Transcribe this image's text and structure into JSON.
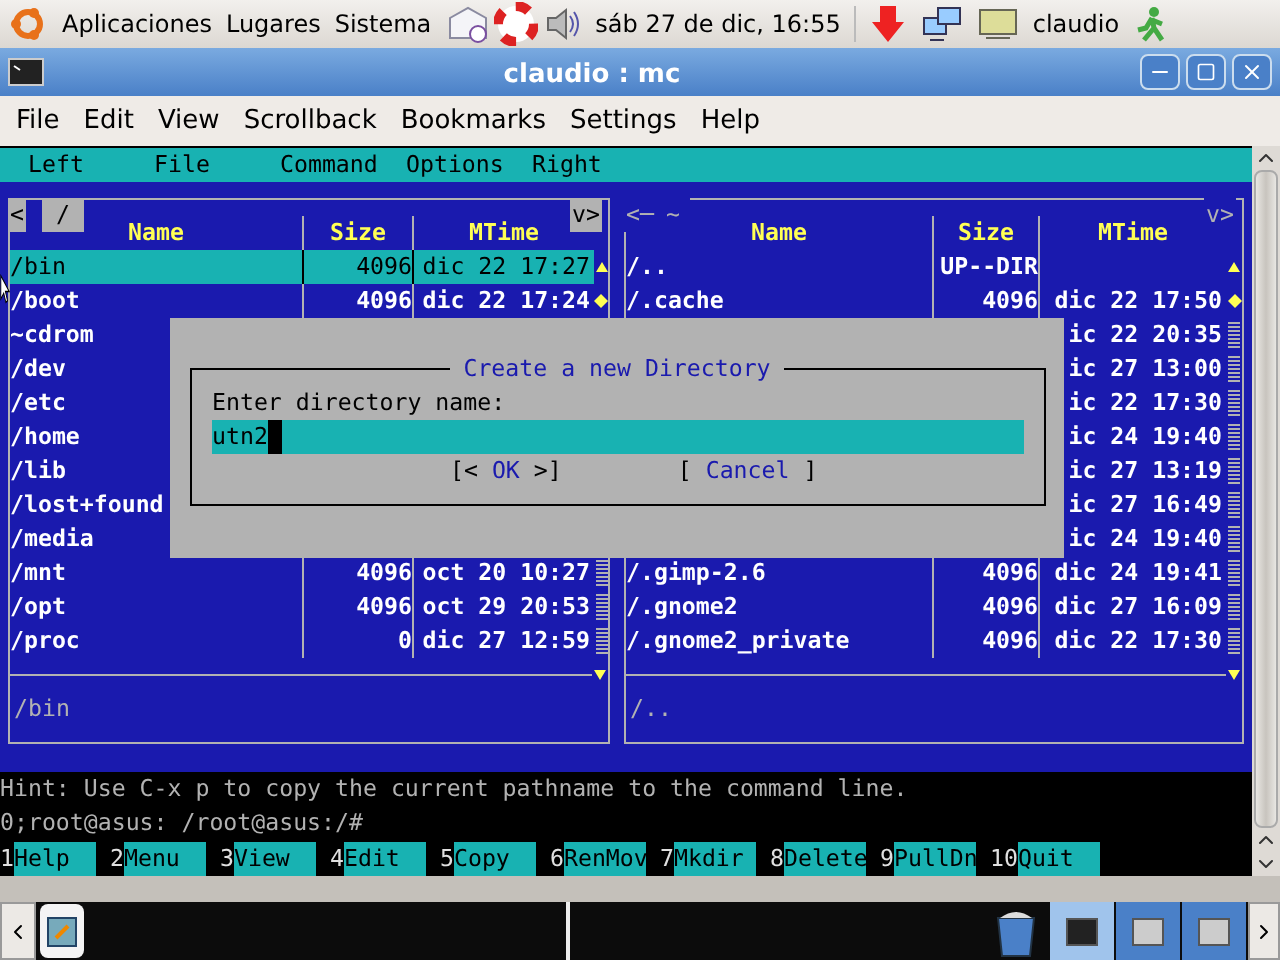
{
  "top_panel": {
    "menus": [
      "Aplicaciones",
      "Lugares",
      "Sistema"
    ],
    "clock": "sáb 27 de dic, 16:55",
    "user": "claudio"
  },
  "window": {
    "title": "claudio : mc"
  },
  "menubar": [
    "File",
    "Edit",
    "View",
    "Scrollback",
    "Bookmarks",
    "Settings",
    "Help"
  ],
  "mc_menu": [
    "Left",
    "File",
    "Command",
    "Options",
    "Right"
  ],
  "left_panel": {
    "left_marker": "<",
    "path": "/",
    "right_marker": "v>",
    "columns": [
      "Name",
      "Size",
      "MTime"
    ],
    "mini_status": "/bin",
    "rows": [
      {
        "name": "/bin",
        "size": "4096",
        "mtime": "dic 22 17:27",
        "selected": true
      },
      {
        "name": "/boot",
        "size": "4096",
        "mtime": "dic 22 17:24",
        "selected": false
      },
      {
        "name": "~cdrom",
        "selected": false
      },
      {
        "name": "/dev",
        "selected": false
      },
      {
        "name": "/etc",
        "selected": false
      },
      {
        "name": "/home",
        "selected": false
      },
      {
        "name": "/lib",
        "selected": false
      },
      {
        "name": "/lost+found",
        "selected": false
      },
      {
        "name": "/media",
        "selected": false
      },
      {
        "name": "/mnt",
        "size": "4096",
        "mtime": "oct 20 10:27",
        "selected": false
      },
      {
        "name": "/opt",
        "size": "4096",
        "mtime": "oct 29 20:53",
        "selected": false
      },
      {
        "name": "/proc",
        "size": "0",
        "mtime": "dic 27 12:59",
        "selected": false
      }
    ]
  },
  "right_panel": {
    "left_marker": "<─",
    "path": "~",
    "right_marker": "v>",
    "columns": [
      "Name",
      "Size",
      "MTime"
    ],
    "mini_status": "/..",
    "rows": [
      {
        "name": "/..",
        "size": "UP--DIR",
        "selected": false
      },
      {
        "name": "/.cache",
        "size": "4096",
        "mtime": "dic 22 17:50",
        "selected": false
      },
      {
        "mtime": "ic 22 20:35",
        "selected": false
      },
      {
        "mtime": "ic 27 13:00",
        "selected": false
      },
      {
        "mtime": "ic 22 17:30",
        "selected": false
      },
      {
        "mtime": "ic 24 19:40",
        "selected": false
      },
      {
        "mtime": "ic 27 13:19",
        "selected": false
      },
      {
        "mtime": "ic 27 16:49",
        "selected": false
      },
      {
        "mtime": "ic 24 19:40",
        "selected": false
      },
      {
        "name": "/.gimp-2.6",
        "size": "4096",
        "mtime": "dic 24 19:41",
        "selected": false
      },
      {
        "name": "/.gnome2",
        "size": "4096",
        "mtime": "dic 27 16:09",
        "selected": false
      },
      {
        "name": "/.gnome2_private",
        "size": "4096",
        "mtime": "dic 22 17:30",
        "selected": false
      }
    ]
  },
  "dialog": {
    "title": "Create a new Directory",
    "label": "Enter directory name:",
    "value": "utn2",
    "buttons": [
      {
        "open": "[<",
        "label": "OK",
        "close": ">]"
      },
      {
        "open": "[",
        "label": "Cancel",
        "close": "]"
      }
    ]
  },
  "hint": "Hint: Use C-x p to copy the current pathname to the command line.",
  "prompt": "0;root@asus: /root@asus:/#",
  "function_keys": [
    {
      "number": "1",
      "label": "Help"
    },
    {
      "number": "2",
      "label": "Menu"
    },
    {
      "number": "3",
      "label": "View"
    },
    {
      "number": "4",
      "label": "Edit"
    },
    {
      "number": "5",
      "label": "Copy"
    },
    {
      "number": "6",
      "label": "RenMov"
    },
    {
      "number": "7",
      "label": "Mkdir"
    },
    {
      "number": "8",
      "label": "Delete"
    },
    {
      "number": "9",
      "label": "PullDn"
    },
    {
      "number": "10",
      "label": "Quit"
    }
  ],
  "taskbar": {
    "windows": [
      {
        "selected": true
      },
      {
        "selected": false
      },
      {
        "selected": false
      }
    ]
  }
}
